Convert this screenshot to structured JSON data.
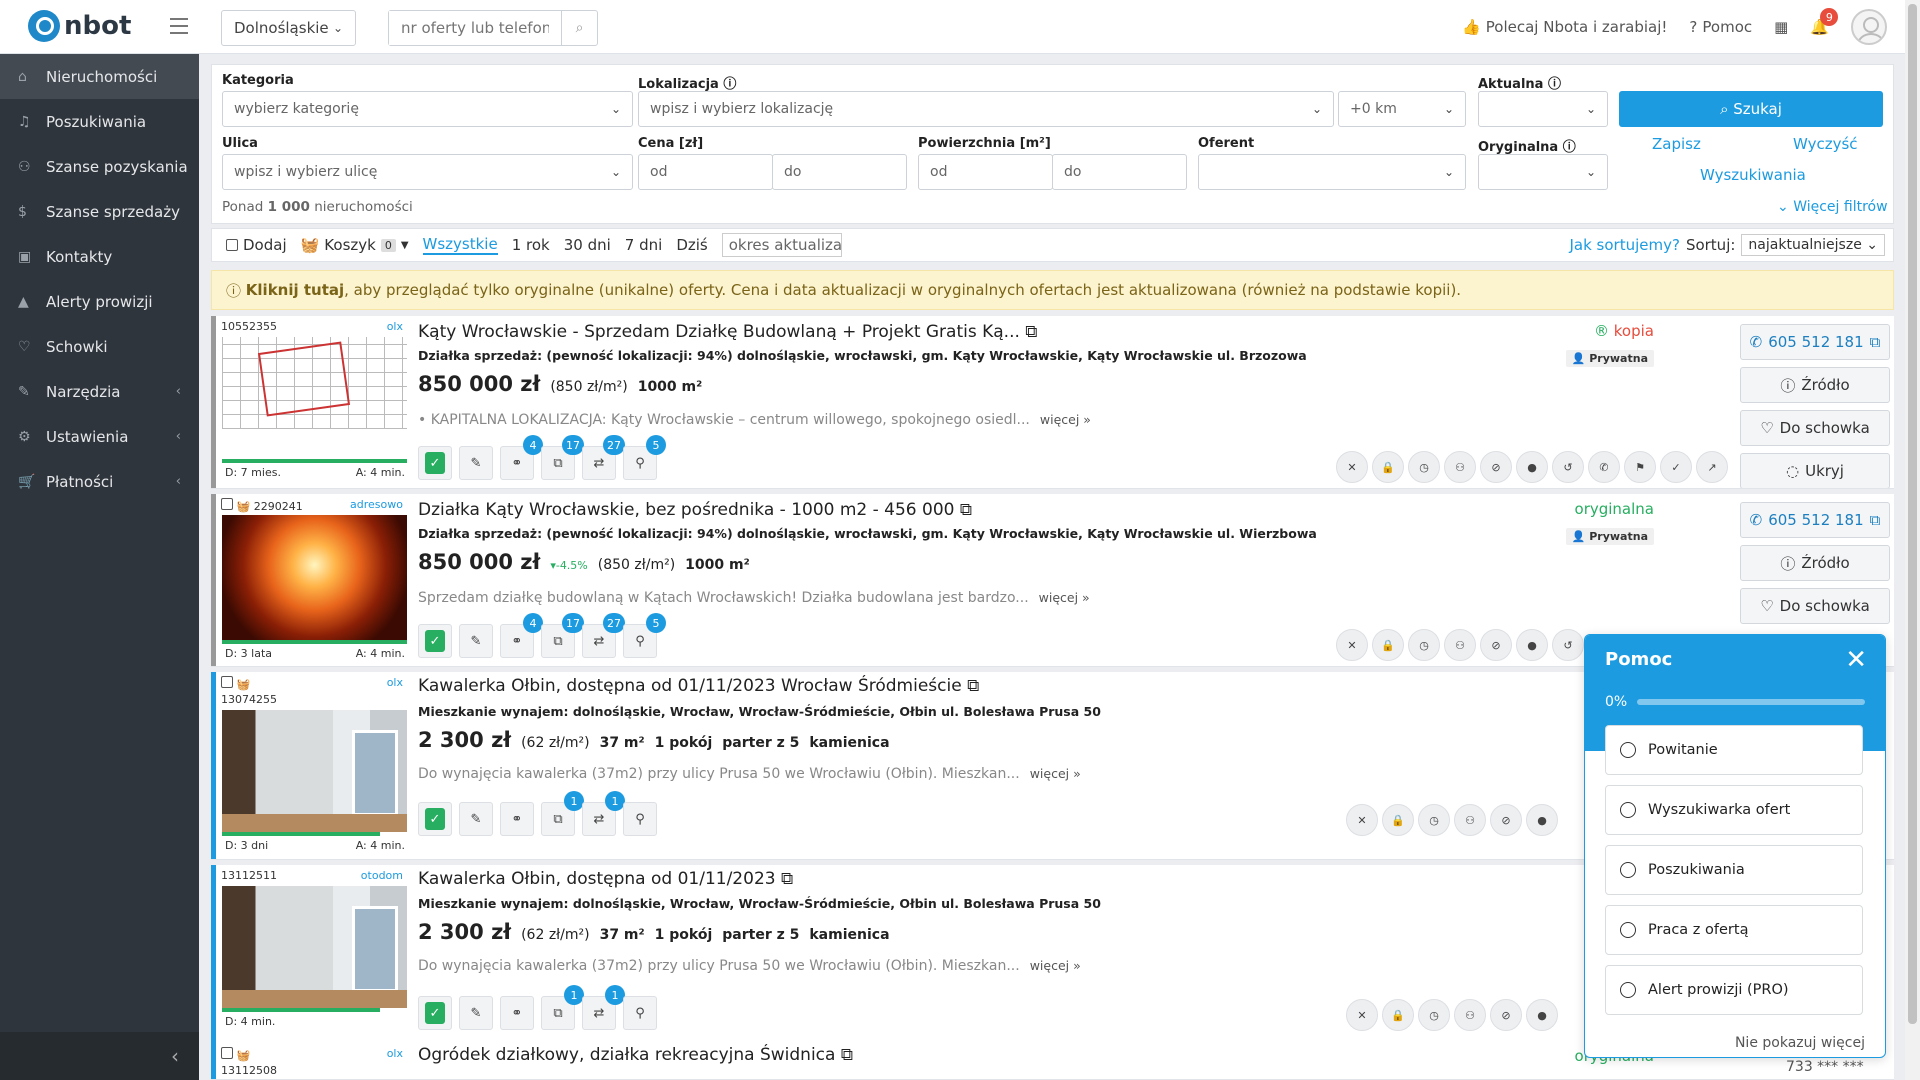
{
  "app": {
    "logo_text": "nbot",
    "region": "Dolnośląskie",
    "search_placeholder": "nr oferty lub telefon",
    "recommend": "Polecaj Nbota i zarabiaj!",
    "help": "Pomoc",
    "notif_count": "9"
  },
  "sidebar": {
    "items": [
      {
        "label": "Nieruchomości",
        "icon": "home-icon"
      },
      {
        "label": "Poszukiwania",
        "icon": "bell-icon"
      },
      {
        "label": "Szanse pozyskania",
        "icon": "handshake-icon"
      },
      {
        "label": "Szanse sprzedaży",
        "icon": "dollar-icon"
      },
      {
        "label": "Kontakty",
        "icon": "contacts-icon"
      },
      {
        "label": "Alerty prowizji",
        "icon": "warning-icon"
      },
      {
        "label": "Schowki",
        "icon": "heart-icon"
      },
      {
        "label": "Narzędzia",
        "icon": "wrench-icon"
      },
      {
        "label": "Ustawienia",
        "icon": "gear-icon"
      },
      {
        "label": "Płatności",
        "icon": "cart-icon"
      }
    ]
  },
  "filters": {
    "kategoria": "Kategoria",
    "kategoria_ph": "wybierz kategorię",
    "lokalizacja": "Lokalizacja",
    "lokalizacja_ph": "wpisz i wybierz lokalizację",
    "radius": "+0 km",
    "aktualna": "Aktualna",
    "search_btn": "Szukaj",
    "ulica": "Ulica",
    "ulica_ph": "wpisz i wybierz ulicę",
    "cena": "Cena [zł]",
    "od": "od",
    "do": "do",
    "powierzchnia": "Powierzchnia [m²]",
    "oferent": "Oferent",
    "oryginalna": "Oryginalna",
    "zapisz": "Zapisz",
    "wyczysc": "Wyczyść",
    "wyszukiwania": "Wyszukiwania",
    "count_prefix": "Ponad",
    "count": "1 000",
    "count_suffix": "nieruchomości",
    "more_filters": "Więcej filtrów"
  },
  "toolbar": {
    "dodaj": "Dodaj",
    "koszyk": "Koszyk",
    "koszyk_count": "0",
    "periods": [
      "Wszystkie",
      "1 rok",
      "30 dni",
      "7 dni",
      "Dziś"
    ],
    "okres_ph": "okres aktualizacji",
    "jak_sortujemy": "Jak sortujemy?",
    "sortuj": "Sortuj:",
    "sort_value": "najaktualniejsze"
  },
  "notice": {
    "bold": "Kliknij tutaj",
    "rest": ", aby przeglądać tylko oryginalne (unikalne) oferty. Cena i data aktualizacji w oryginalnych ofertach jest aktualizowana (również na podstawie kopii)."
  },
  "listings": [
    {
      "id": "10552355",
      "source": "olx",
      "title": "Kąty Wrocławskie - Sprzedam Działkę Budowlaną + Projekt Gratis Ką...",
      "subtitle": "Działka sprzedaż: (pewność lokalizacji: 94%) dolnośląskie, wrocławski, gm. Kąty Wrocławskie, Kąty Wrocławskie ul. Brzozowa",
      "price": "850 000 zł",
      "per_m": "(850 zł/m²)",
      "area": "1000 m²",
      "desc": "• KAPITALNA LOKALIZACJA: Kąty Wrocławskie – centrum willowego, spokojnego osiedl...",
      "more": "więcej »",
      "status": "kopia",
      "tag": "Prywatna",
      "phone": "605 512 181",
      "d_age": "D: 7 mies.",
      "a_age": "A: 4 min.",
      "counts": [
        "4",
        "17",
        "27",
        "5"
      ],
      "age_fill": 0.9
    },
    {
      "id": "2290241",
      "source": "adresowo",
      "title": "Działka Kąty Wrocławskie, bez pośrednika - 1000 m2 - 456 000",
      "subtitle": "Działka sprzedaż: (pewność lokalizacji: 94%) dolnośląskie, wrocławski, gm. Kąty Wrocławskie, Kąty Wrocławskie ul. Wierzbowa",
      "price": "850 000 zł",
      "change": "-4.5%",
      "per_m": "(850 zł/m²)",
      "area": "1000 m²",
      "desc": "Sprzedam działkę budowlaną w Kątach Wrocławskich! Działka budowlana jest bardzo...",
      "more": "więcej »",
      "status": "oryginalna",
      "tag": "Prywatna",
      "phone": "605 512 181",
      "d_age": "D: 3 lata",
      "a_age": "A: 4 min.",
      "counts": [
        "4",
        "17",
        "27",
        "5"
      ],
      "age_fill": 1.0
    },
    {
      "id": "13074255",
      "source": "olx",
      "title": "Kawalerka Ołbin, dostępna od 01/11/2023 Wrocław Śródmieście",
      "subtitle": "Mieszkanie wynajem: dolnośląskie, Wrocław, Wrocław-Śródmieście, Ołbin ul. Bolesława Prusa 50",
      "price": "2 300 zł",
      "per_m": "(62 zł/m²)",
      "area": "37 m²",
      "rooms": "1 pokój",
      "floor": "parter z 5",
      "building": "kamienica",
      "desc": "Do wynajęcia kawalerka (37m2) przy ulicy Prusa 50 we Wrocławiu (Ołbin). Mieszkan...",
      "more": "więcej »",
      "d_age": "D: 3 dni",
      "a_age": "A: 4 min.",
      "counts": [
        "1",
        "1"
      ],
      "age_fill": 0.85
    },
    {
      "id": "13112511",
      "source": "otodom",
      "title": "Kawalerka Ołbin, dostępna od 01/11/2023",
      "subtitle": "Mieszkanie wynajem: dolnośląskie, Wrocław, Wrocław-Śródmieście, Ołbin ul. Bolesława Prusa 50",
      "price": "2 300 zł",
      "per_m": "(62 zł/m²)",
      "area": "37 m²",
      "rooms": "1 pokój",
      "floor": "parter z 5",
      "building": "kamienica",
      "desc": "Do wynajęcia kawalerka (37m2) przy ulicy Prusa 50 we Wrocławiu (Ołbin). Mieszkan...",
      "more": "więcej »",
      "d_age": "D: 4 min.",
      "a_age": "",
      "counts": [
        "1",
        "1"
      ],
      "age_fill": 0.85
    },
    {
      "id": "13112508",
      "source": "olx",
      "title": "Ogródek działkowy, działka rekreacyjna Świdnica",
      "status": "oryginalna",
      "phone": "733 *** ***"
    }
  ],
  "buttons": {
    "zrodlo": "Źródło",
    "schowek": "Do schowka",
    "ukryj": "Ukryj"
  },
  "help_panel": {
    "title": "Pomoc",
    "progress": "0%",
    "items": [
      "Powitanie",
      "Wyszukiwarka ofert",
      "Poszukiwania",
      "Praca z ofertą",
      "Alert prowizji (PRO)"
    ],
    "dismiss": "Nie pokazuj więcej"
  },
  "colors": {
    "accent": "#1c9be0",
    "sidebar": "#2f353c",
    "kopia": "#e74c3c",
    "oryginalna": "#27ae60"
  }
}
